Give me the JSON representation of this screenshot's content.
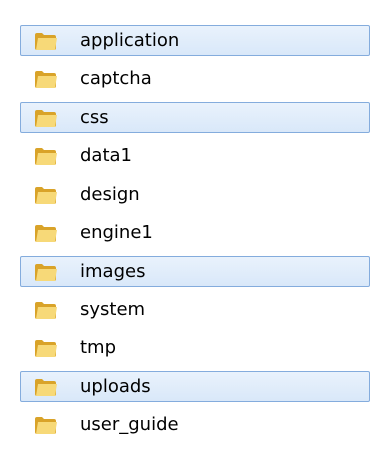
{
  "folder_icon": "folder-icon",
  "colors": {
    "selection_fill": "#dceafa",
    "selection_border": "#84acdd",
    "folder_light": "#f7d978",
    "folder_dark": "#d9a329"
  },
  "folders": [
    {
      "name": "application",
      "selected": true
    },
    {
      "name": "captcha",
      "selected": false
    },
    {
      "name": "css",
      "selected": true
    },
    {
      "name": "data1",
      "selected": false
    },
    {
      "name": "design",
      "selected": false
    },
    {
      "name": "engine1",
      "selected": false
    },
    {
      "name": "images",
      "selected": true
    },
    {
      "name": "system",
      "selected": false
    },
    {
      "name": "tmp",
      "selected": false
    },
    {
      "name": "uploads",
      "selected": true
    },
    {
      "name": "user_guide",
      "selected": false
    }
  ]
}
